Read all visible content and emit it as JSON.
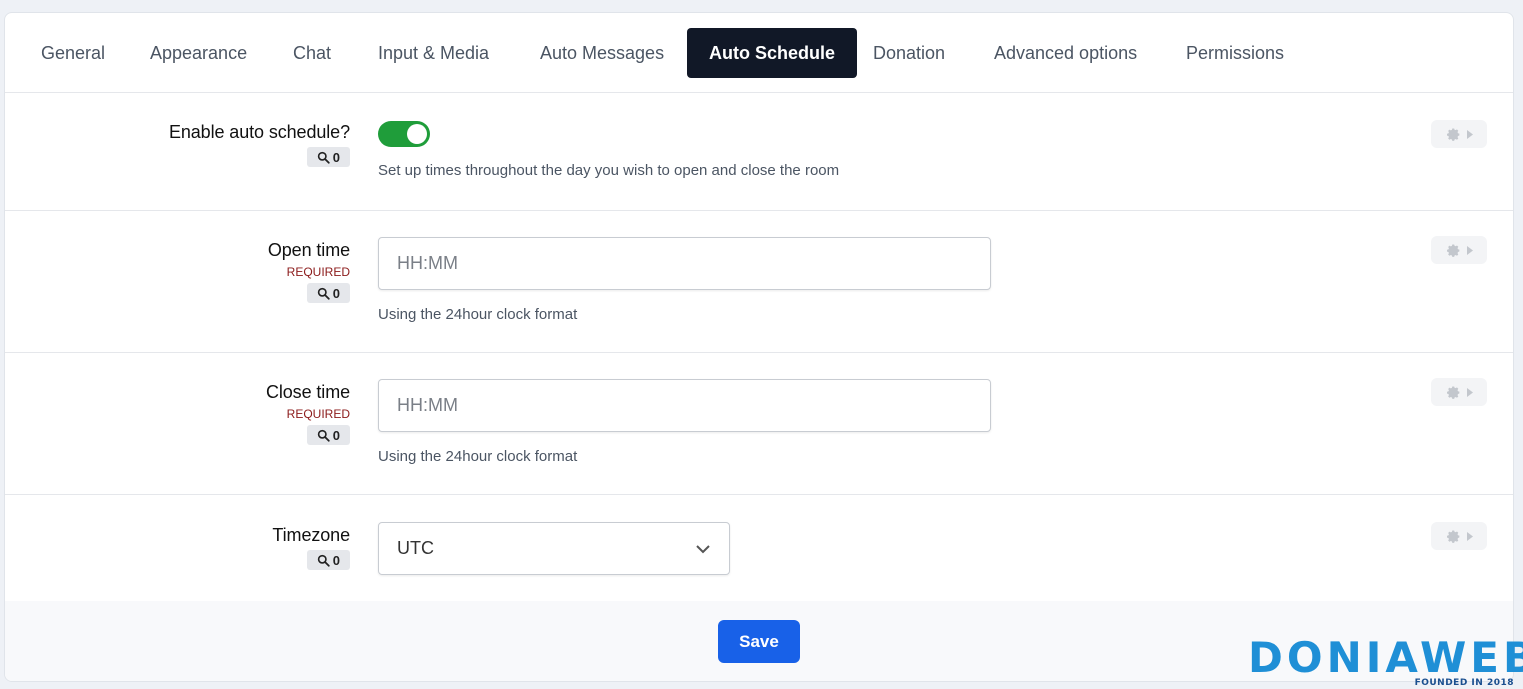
{
  "tabs": [
    {
      "label": "General"
    },
    {
      "label": "Appearance"
    },
    {
      "label": "Chat"
    },
    {
      "label": "Input & Media"
    },
    {
      "label": "Auto Messages"
    },
    {
      "label": "Auto Schedule",
      "active": true
    },
    {
      "label": "Donation"
    },
    {
      "label": "Advanced options"
    },
    {
      "label": "Permissions"
    }
  ],
  "fields": {
    "enable": {
      "label": "Enable auto schedule?",
      "search_count": "0",
      "enabled": true,
      "help": "Set up times throughout the day you wish to open and close the room"
    },
    "open_time": {
      "label": "Open time",
      "required": "REQUIRED",
      "search_count": "0",
      "placeholder": "HH:MM",
      "value": "",
      "help": "Using the 24hour clock format"
    },
    "close_time": {
      "label": "Close time",
      "required": "REQUIRED",
      "search_count": "0",
      "placeholder": "HH:MM",
      "value": "",
      "help": "Using the 24hour clock format"
    },
    "timezone": {
      "label": "Timezone",
      "search_count": "0",
      "selected": "UTC"
    }
  },
  "footer": {
    "save_label": "Save"
  },
  "watermark": {
    "brand": "DONIAWEB",
    "tagline": "FOUNDED IN 2018"
  },
  "colors": {
    "active_tab_bg": "#111827",
    "toggle_on": "#1f9d3a",
    "save_button": "#1861e8",
    "required_text": "#8b1a1a",
    "watermark": "#1f8fd6"
  }
}
